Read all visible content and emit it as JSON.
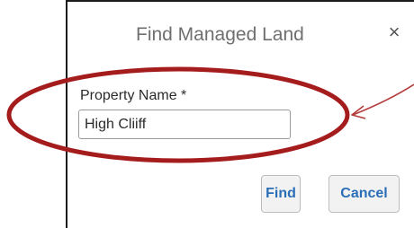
{
  "dialog": {
    "title": "Find Managed Land",
    "close_symbol": "×",
    "field_label": "Property Name *",
    "field_value": "High Cliiff",
    "find_label": "Find",
    "cancel_label": "Cancel"
  },
  "annotation": {
    "color": "#a51c1c",
    "marks": [
      "ellipse-highlight",
      "arrow-pointer"
    ]
  },
  "colors": {
    "button_text": "#2a6eb8",
    "title_text": "#6f6f6f"
  }
}
